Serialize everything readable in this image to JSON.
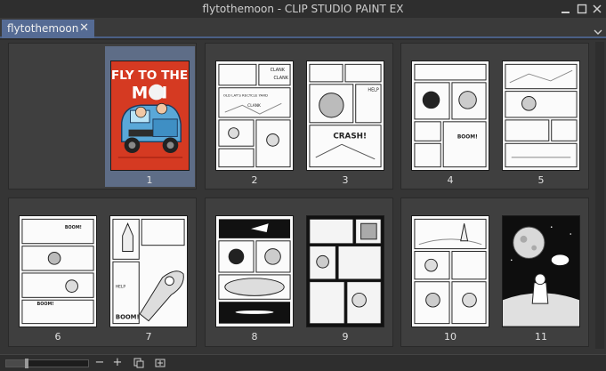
{
  "window": {
    "title": "flytothemoon - CLIP STUDIO PAINT EX"
  },
  "tabs": [
    {
      "label": "flytothemoon",
      "close": "✕"
    }
  ],
  "pages": [
    {
      "number": "1",
      "selected": true,
      "cover_text_1": "FLY TO THE",
      "cover_text_2": "M  N"
    },
    {
      "number": "2",
      "selected": false,
      "sfx": [
        "CLANK",
        "CLANK",
        "OLD LAY'S RECYCLE YARD",
        "CLANK"
      ]
    },
    {
      "number": "3",
      "selected": false,
      "sfx": [
        "HELP",
        "CRASH!"
      ]
    },
    {
      "number": "4",
      "selected": false,
      "sfx": [
        "BOOM!"
      ]
    },
    {
      "number": "5",
      "selected": false,
      "sfx": []
    },
    {
      "number": "6",
      "selected": false,
      "sfx": [
        "BOOM!",
        "BOOM!"
      ]
    },
    {
      "number": "7",
      "selected": false,
      "sfx": [
        "BOOM!",
        "HELP"
      ]
    },
    {
      "number": "8",
      "selected": false,
      "sfx": []
    },
    {
      "number": "9",
      "selected": false,
      "sfx": []
    },
    {
      "number": "10",
      "selected": false,
      "sfx": []
    },
    {
      "number": "11",
      "selected": false,
      "sfx": []
    }
  ],
  "statusbar": {
    "zoom_out": "−",
    "zoom_in": "+",
    "zoom_level": 0.25
  }
}
